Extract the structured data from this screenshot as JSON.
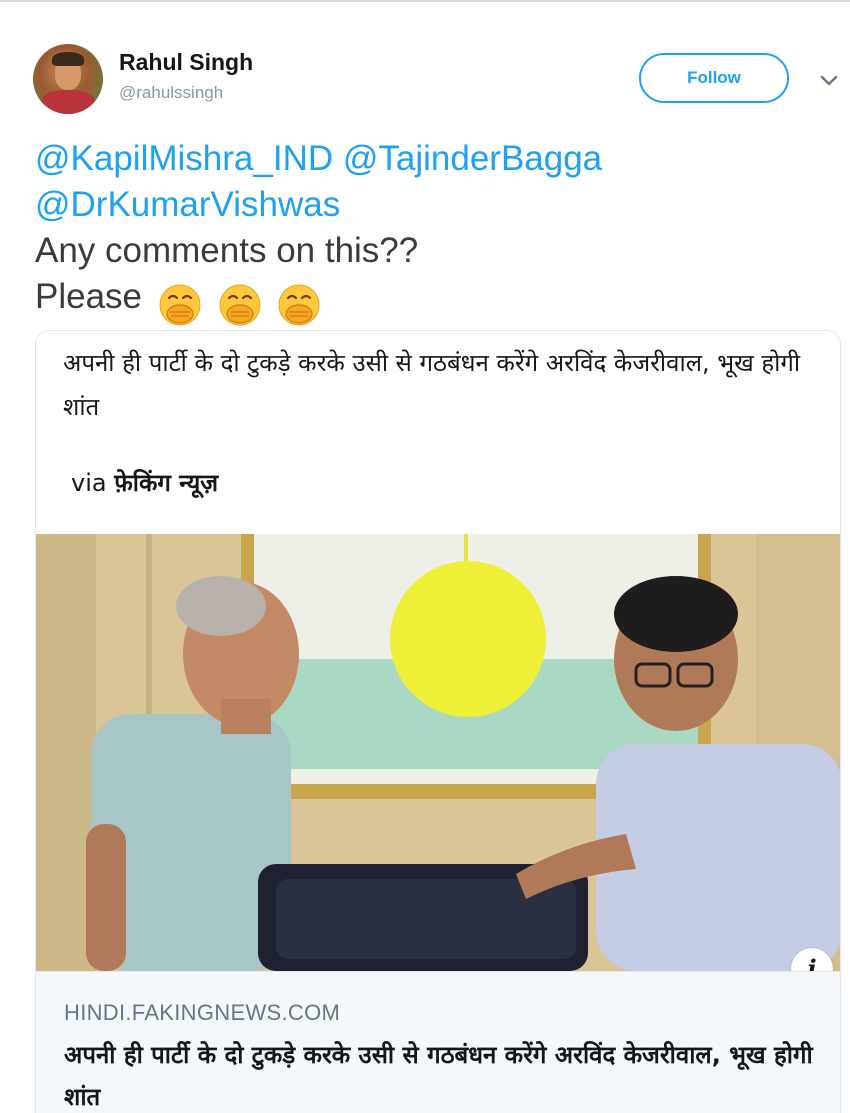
{
  "author": {
    "display_name": "Rahul Singh",
    "handle": "@rahulssingh",
    "avatar_icon": "profile-photo"
  },
  "header": {
    "follow_label": "Follow",
    "menu_icon": "chevron-down-icon"
  },
  "tweet": {
    "mentions_line1": "@KapilMishra_IND @TajinderBagga",
    "mentions_line2": "@DrKumarVishwas",
    "line3": "Any comments on this??",
    "line4": "Please",
    "emoji_icon": "face-with-hand-over-mouth"
  },
  "card": {
    "quote": "अपनी ही पार्टी के दो टुकड़े करके उसी से गठबंधन करेंगे अरविंद केजरीवाल, भूख होगी शांत",
    "via_prefix": "via",
    "via_source": "फ़ेकिंग न्यूज़",
    "info_icon": "i",
    "domain": "HINDI.FAKINGNEWS.COM",
    "title": "अपनी ही पार्टी के दो टुकड़े करके उसी से गठबंधन करेंगे अरविंद केजरीवाल, भूख होगी शांत"
  },
  "colors": {
    "link": "#1da1f2",
    "muted": "#8899a6",
    "text": "#14171a"
  }
}
